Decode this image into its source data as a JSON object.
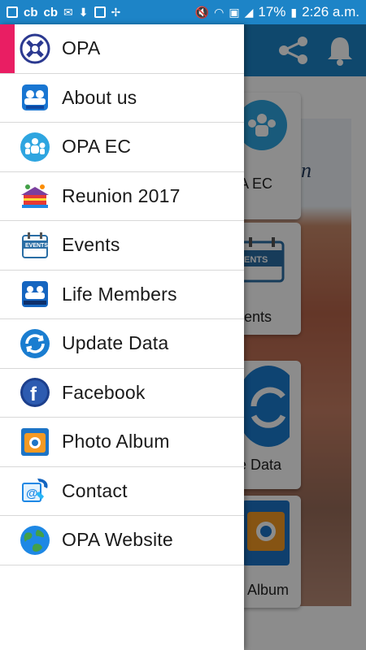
{
  "status_bar": {
    "left_texts": [
      "cb",
      "cb"
    ],
    "battery_percent": "17%",
    "time": "2:26 a.m.",
    "bg_color": "#1d84c7"
  },
  "background_app": {
    "toolbar_color": "#1d84c7",
    "tiles": [
      {
        "label": "A EC",
        "icon": "team-icon"
      },
      {
        "label": "ents",
        "icon": "events-icon"
      },
      {
        "label": "te Data",
        "icon": "update-icon"
      },
      {
        "label": "Album",
        "icon": "photo-album-icon"
      }
    ]
  },
  "drawer": {
    "accent_color": "#e91e63",
    "items": [
      {
        "label": "OPA",
        "icon": "opa-logo-icon",
        "active": true
      },
      {
        "label": "About us",
        "icon": "about-us-icon"
      },
      {
        "label": "OPA EC",
        "icon": "opa-ec-icon"
      },
      {
        "label": "Reunion 2017",
        "icon": "reunion-icon"
      },
      {
        "label": "Events",
        "icon": "events-icon"
      },
      {
        "label": "Life Members",
        "icon": "life-members-icon"
      },
      {
        "label": "Update Data",
        "icon": "update-data-icon"
      },
      {
        "label": "Facebook",
        "icon": "facebook-icon"
      },
      {
        "label": "Photo Album",
        "icon": "photo-album-icon"
      },
      {
        "label": "Contact",
        "icon": "contact-icon"
      },
      {
        "label": "OPA Website",
        "icon": "website-globe-icon"
      }
    ]
  }
}
